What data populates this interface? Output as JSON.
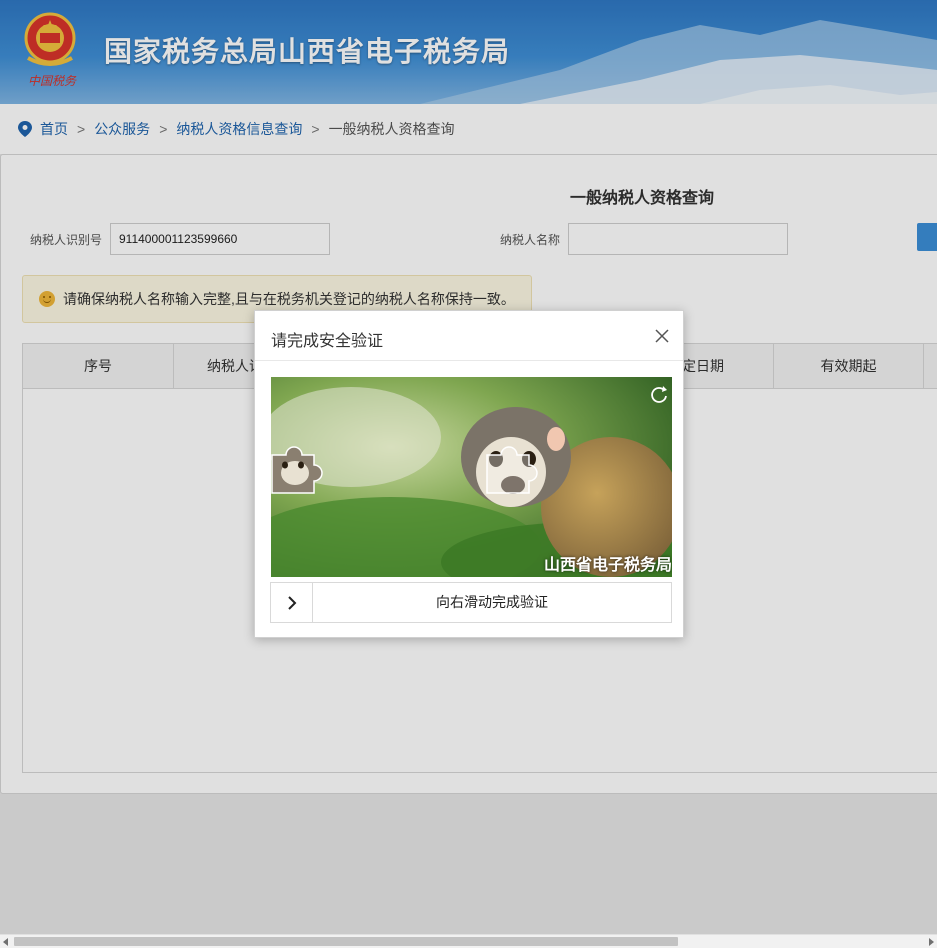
{
  "header": {
    "site_title": "国家税务总局山西省电子税务局",
    "logo_text": "中国税务",
    "icon": "tax-emblem-icon"
  },
  "breadcrumb": {
    "items": [
      "首页",
      "公众服务",
      "纳税人资格信息查询"
    ],
    "separator": ">",
    "current": "一般纳税人资格查询"
  },
  "query_form": {
    "title": "一般纳税人资格查询",
    "taxpayer_id_label": "纳税人识别号",
    "taxpayer_id_value": "911400001123599660",
    "taxpayer_name_label": "纳税人名称",
    "taxpayer_name_value": ""
  },
  "notice": {
    "text": "请确保纳税人名称输入完整,且与在税务机关登记的纳税人名称保持一致。",
    "icon": "smile-icon"
  },
  "results_table": {
    "columns": [
      "序号",
      "纳税人识",
      "定日期",
      "有效期起"
    ]
  },
  "captcha_dialog": {
    "title": "请完成安全验证",
    "watermark": "山西省电子税务局",
    "slider_text": "向右滑动完成验证",
    "progress": 0
  },
  "colors": {
    "header_blue": "#2f78c4",
    "link_blue": "#1f64ad",
    "notice_bg": "#fcf8e3",
    "button_blue": "#3c8fd8"
  }
}
